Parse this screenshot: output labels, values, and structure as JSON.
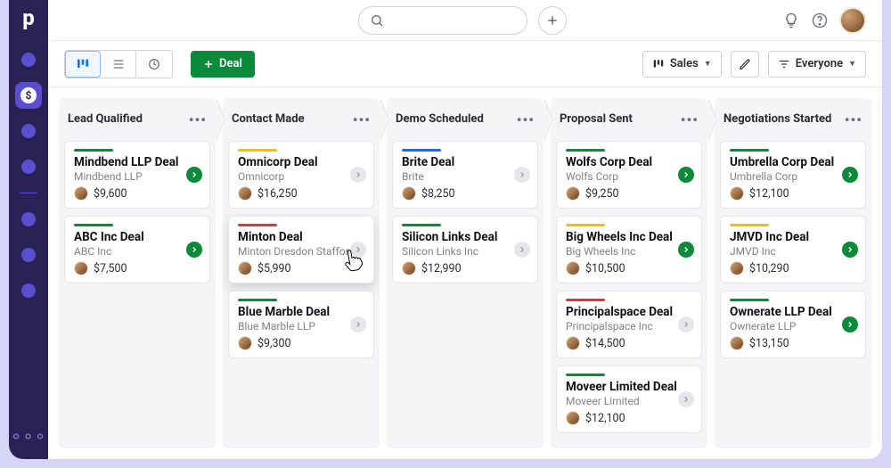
{
  "toolbar": {
    "add_deal_label": "Deal",
    "pipeline_label": "Sales",
    "filter_label": "Everyone"
  },
  "columns": [
    {
      "title": "Lead Qualified",
      "cards": [
        {
          "title": "Mindbend LLP Deal",
          "org": "Mindbend LLP",
          "amount": "$9,600",
          "bar": "green",
          "badge": "green"
        },
        {
          "title": "ABC Inc Deal",
          "org": "ABC Inc",
          "amount": "$7,500",
          "bar": "green",
          "badge": "green"
        }
      ]
    },
    {
      "title": "Contact Made",
      "cards": [
        {
          "title": "Omnicorp Deal",
          "org": "Omnicorp",
          "amount": "$16,250",
          "bar": "yellow",
          "badge": "grey"
        },
        {
          "title": "Minton Deal",
          "org": "Minton Dresdon Stafford",
          "amount": "$5,990",
          "bar": "red",
          "badge": "grey",
          "dragging": true
        },
        {
          "title": "Blue Marble Deal",
          "org": "Blue Marble LLP",
          "amount": "$9,300",
          "bar": "green",
          "badge": "grey"
        }
      ]
    },
    {
      "title": "Demo Scheduled",
      "cards": [
        {
          "title": "Brite Deal",
          "org": "Brite",
          "amount": "$8,250",
          "bar": "blue",
          "badge": "grey"
        },
        {
          "title": "Silicon Links Deal",
          "org": "Silicon Links Inc",
          "amount": "$12,990",
          "bar": "green",
          "badge": "grey"
        }
      ]
    },
    {
      "title": "Proposal Sent",
      "cards": [
        {
          "title": "Wolfs Corp Deal",
          "org": "Wolfs Corp",
          "amount": "$9,250",
          "bar": "green",
          "badge": "green"
        },
        {
          "title": "Big Wheels Inc Deal",
          "org": "Big Wheels Inc",
          "amount": "$10,500",
          "bar": "yellow",
          "badge": "green"
        },
        {
          "title": "Principalspace Deal",
          "org": "Principalspace Inc",
          "amount": "$14,500",
          "bar": "red",
          "badge": "grey"
        },
        {
          "title": "Moveer Limited Deal",
          "org": "Moveer Limited",
          "amount": "$12,100",
          "bar": "green",
          "badge": "grey"
        }
      ]
    },
    {
      "title": "Negotiations Started",
      "cards": [
        {
          "title": "Umbrella Corp Deal",
          "org": "Umbrella Corp",
          "amount": "$12,100",
          "bar": "green",
          "badge": "green"
        },
        {
          "title": "JMVD Inc Deal",
          "org": "JMVD Inc",
          "amount": "$10,290",
          "bar": "yellow",
          "badge": "green"
        },
        {
          "title": "Ownerate LLP Deal",
          "org": "Ownerate LLP",
          "amount": "$13,150",
          "bar": "green",
          "badge": "green"
        }
      ]
    }
  ]
}
